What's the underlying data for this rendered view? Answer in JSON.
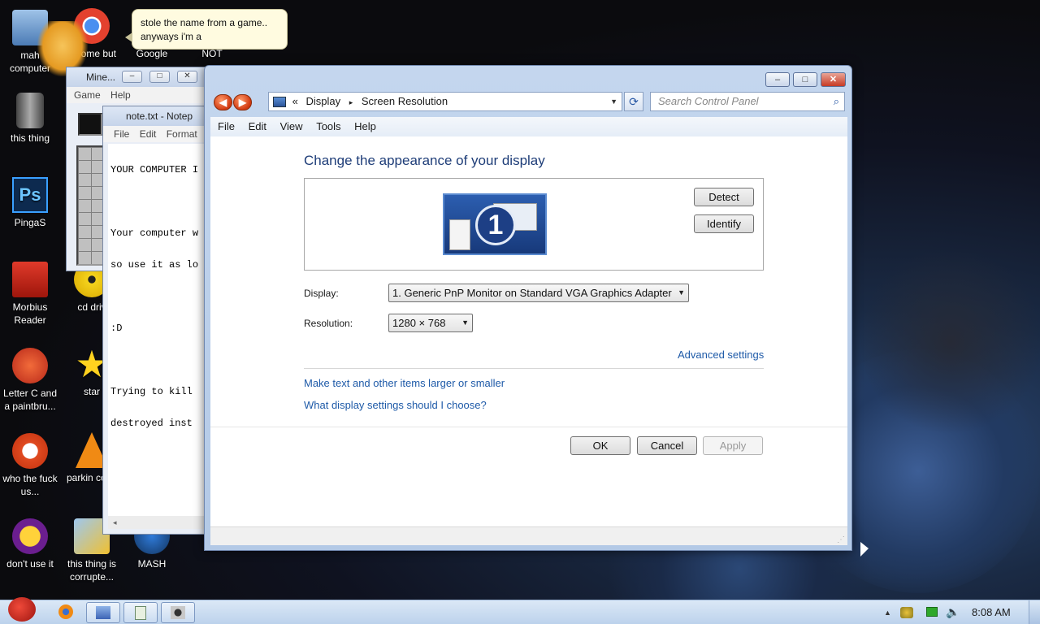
{
  "desktop": {
    "icons": [
      {
        "label": "mah computer"
      },
      {
        "label": "this thing"
      },
      {
        "label": "PingaS"
      },
      {
        "label": "Morbius Reader"
      },
      {
        "label": "Letter C and a paintbru..."
      },
      {
        "label": "who the fuck us..."
      },
      {
        "label": "don't use it"
      },
      {
        "label": "chrome but"
      },
      {
        "label": "Google"
      },
      {
        "label": "NOT"
      },
      {
        "label": "cd driv"
      },
      {
        "label": "star"
      },
      {
        "label": "parkin cone"
      },
      {
        "label": "this thing is corrupte..."
      },
      {
        "label": "MASH"
      }
    ],
    "bubble": {
      "line1": "stole the name from a game..",
      "line2": "anyways i'm a"
    }
  },
  "minesweeper": {
    "title": "Mine...",
    "menu": [
      "Game",
      "Help"
    ]
  },
  "notepad": {
    "title": "note.txt - Notep",
    "menu": [
      "File",
      "Edit",
      "Format"
    ],
    "lines": [
      "YOUR COMPUTER I",
      "",
      "Your computer w",
      "so use it as lo",
      "",
      ":D",
      "",
      "Trying to kill",
      "destroyed inst"
    ]
  },
  "control_panel": {
    "window_controls": {
      "minimize": "–",
      "maximize": "□",
      "close": "✕"
    },
    "address": {
      "chevron": "«",
      "crumb1": "Display",
      "sep": "▸",
      "crumb2": "Screen Resolution"
    },
    "search_placeholder": "Search Control Panel",
    "menu": [
      "File",
      "Edit",
      "View",
      "Tools",
      "Help"
    ],
    "title": "Change the appearance of your display",
    "monitor_number": "1",
    "buttons": {
      "detect": "Detect",
      "identify": "Identify",
      "ok": "OK",
      "cancel": "Cancel",
      "apply": "Apply"
    },
    "display_label": "Display:",
    "display_value": "1. Generic PnP Monitor on Standard VGA Graphics Adapter",
    "resolution_label": "Resolution:",
    "resolution_value": "1280 × 768",
    "links": {
      "advanced": "Advanced settings",
      "text_size": "Make text and other items larger or smaller",
      "what_settings": "What display settings should I choose?"
    }
  },
  "taskbar": {
    "clock": "8:08 AM",
    "tray_arrow": "▲"
  },
  "colors": {
    "accent_link": "#1e5aa8",
    "title_blue": "#1e3d78",
    "window_frame": "#b3c9e6"
  }
}
